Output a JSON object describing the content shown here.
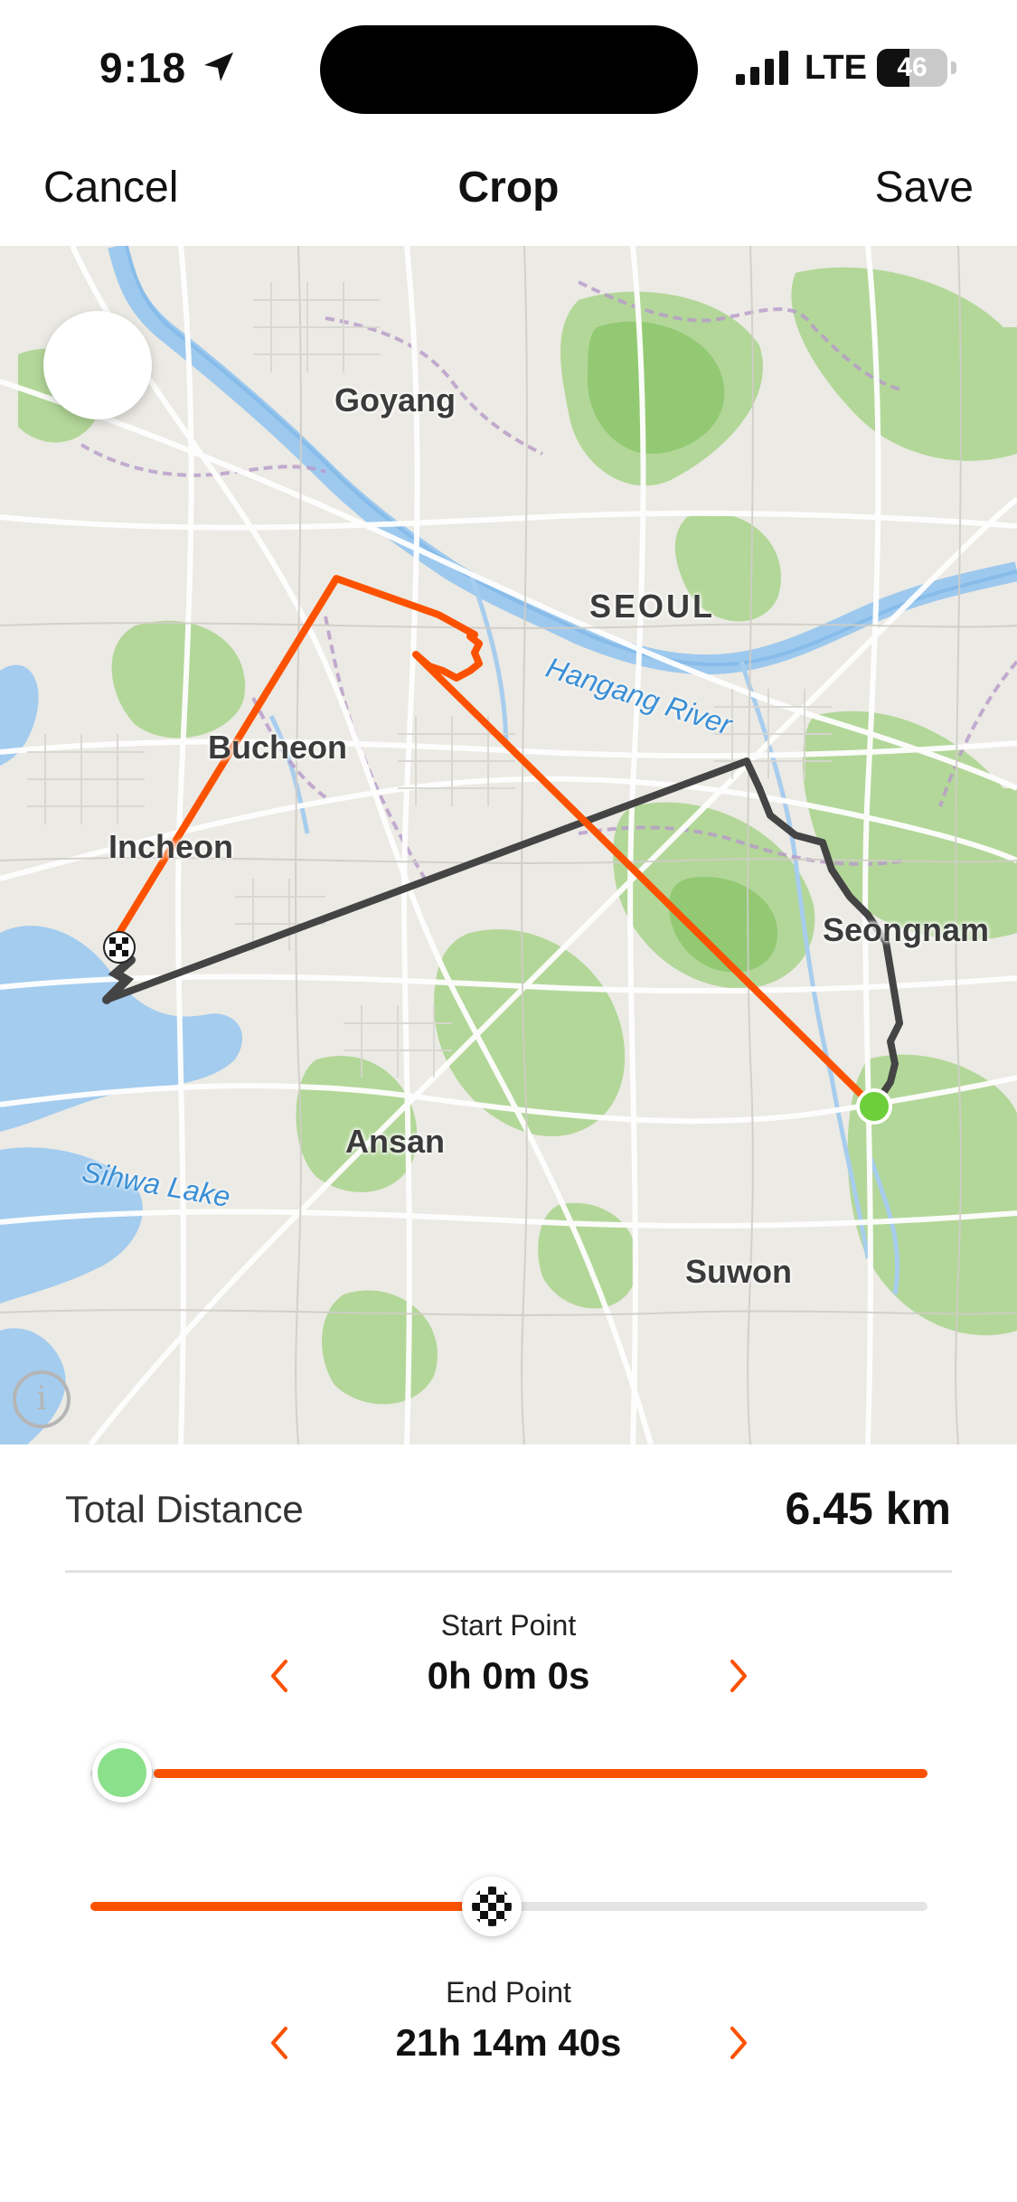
{
  "status_bar": {
    "time": "9:18",
    "network": "LTE",
    "battery": "46",
    "battery_level_percent": 46
  },
  "nav": {
    "cancel_label": "Cancel",
    "title": "Crop",
    "save_label": "Save"
  },
  "map": {
    "labels": {
      "goyang": "Goyang",
      "seoul": "SEOUL",
      "bucheon": "Bucheon",
      "incheon": "Incheon",
      "seongnam": "Seongnam",
      "ansan": "Ansan",
      "suwon": "Suwon",
      "hangang_river": "Hangang River",
      "sihwa_lake": "Sihwa Lake"
    },
    "info_glyph": "i",
    "route_active_color": "#FC5200",
    "route_cropped_color": "#444444",
    "start_marker_color": "#6DCF3A"
  },
  "summary": {
    "total_distance_label": "Total Distance",
    "total_distance_value": "6.45 km"
  },
  "start_point": {
    "label": "Start Point",
    "time": "0h 0m 0s",
    "slider_position_fraction": 0.0
  },
  "end_point": {
    "label": "End Point",
    "time": "21h 14m 40s",
    "slider_position_fraction": 0.48
  },
  "colors": {
    "accent": "#FC5200",
    "start_knob": "#8BE08B"
  }
}
